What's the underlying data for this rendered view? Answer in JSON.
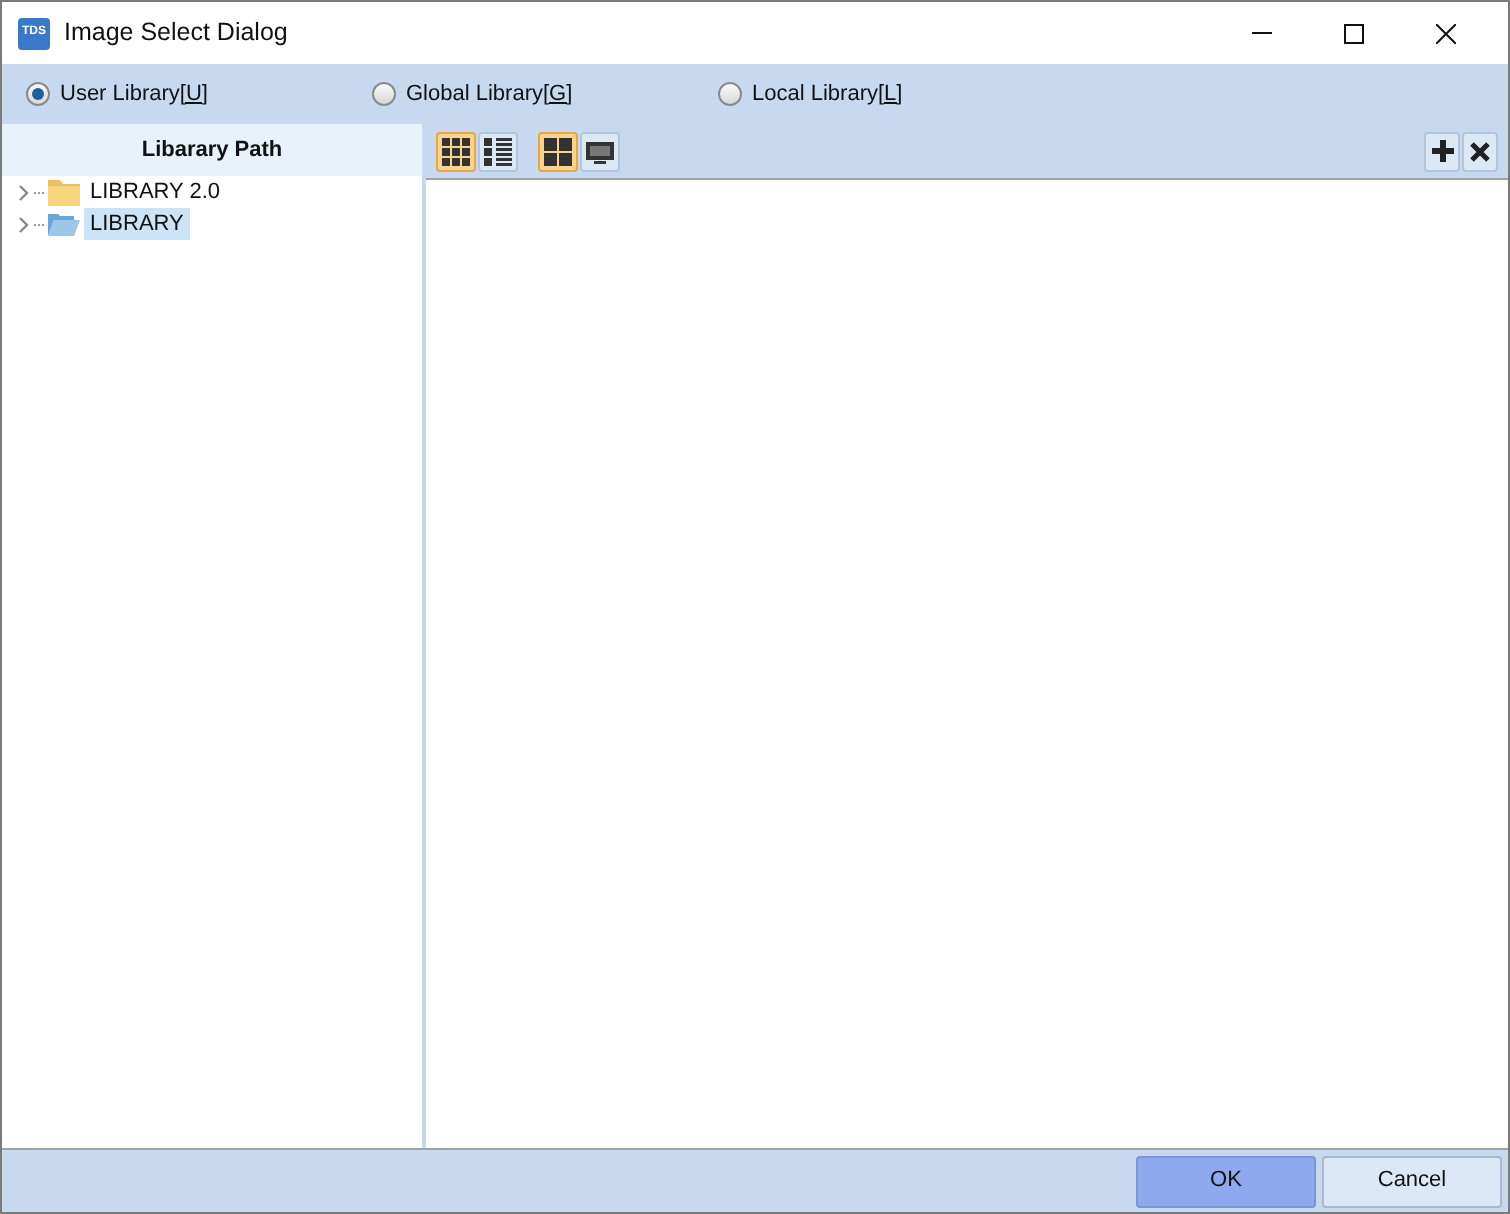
{
  "window": {
    "title": "Image Select Dialog",
    "app_icon": "TDS"
  },
  "library_options": [
    {
      "label": "User Library",
      "access_key": "[U]",
      "selected": true
    },
    {
      "label": "Global Library",
      "access_key": "[G]",
      "selected": false
    },
    {
      "label": "Local Library",
      "access_key": "[L]",
      "selected": false
    }
  ],
  "tree": {
    "header": "Libarary Path",
    "items": [
      {
        "label": "LIBRARY 2.0",
        "selected": false,
        "expanded": false
      },
      {
        "label": "LIBRARY",
        "selected": true,
        "expanded": false
      }
    ]
  },
  "toolbar": {
    "view_groups": [
      [
        {
          "kind": "grid",
          "selected": true
        },
        {
          "kind": "list",
          "selected": false
        }
      ],
      [
        {
          "kind": "tiles",
          "selected": true
        },
        {
          "kind": "preview",
          "selected": false
        }
      ]
    ],
    "actions": [
      {
        "kind": "add"
      },
      {
        "kind": "remove"
      }
    ]
  },
  "buttons": [
    {
      "label": "OK",
      "default": true
    },
    {
      "label": "Cancel",
      "default": false
    }
  ]
}
